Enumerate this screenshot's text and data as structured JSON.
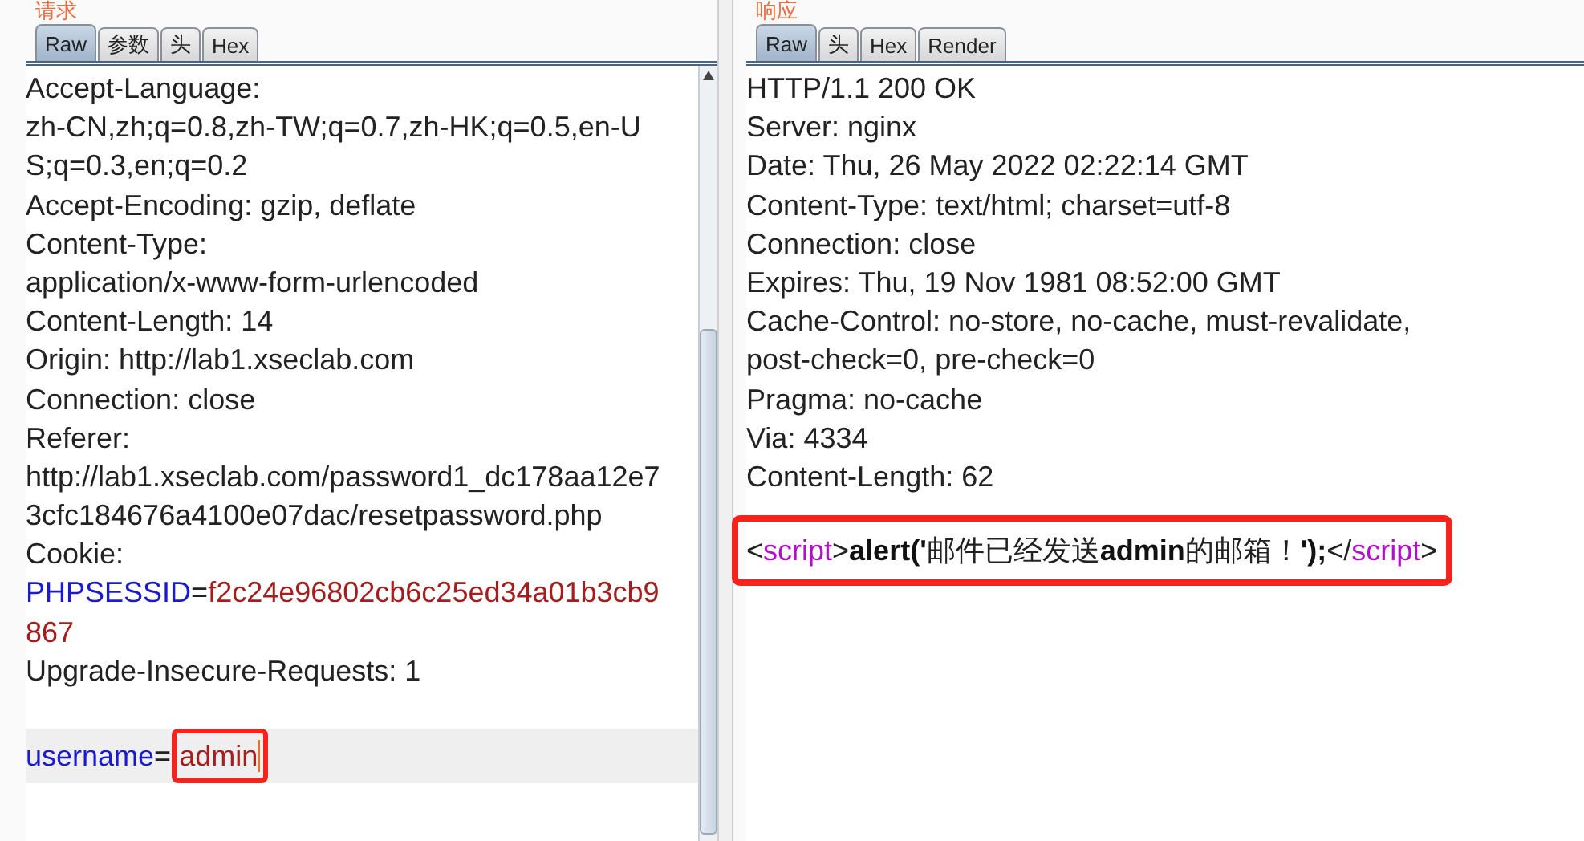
{
  "request": {
    "heading": "请求",
    "tabs": [
      {
        "label": "Raw",
        "selected": true
      },
      {
        "label": "参数",
        "selected": false
      },
      {
        "label": "头",
        "selected": false
      },
      {
        "label": "Hex",
        "selected": false
      }
    ],
    "lines": [
      {
        "segments": [
          {
            "text": "Accept-Language:",
            "kind": "plain"
          }
        ]
      },
      {
        "segments": [
          {
            "text": "zh-CN,zh;q=0.8,zh-TW;q=0.7,zh-HK;q=0.5,en-U",
            "kind": "plain"
          }
        ]
      },
      {
        "segments": [
          {
            "text": "S;q=0.3,en;q=0.2",
            "kind": "plain"
          }
        ]
      },
      {
        "segments": [
          {
            "text": "Accept-Encoding: gzip, deflate",
            "kind": "plain"
          }
        ]
      },
      {
        "segments": [
          {
            "text": "Content-Type:",
            "kind": "plain"
          }
        ]
      },
      {
        "segments": [
          {
            "text": "application/x-www-form-urlencoded",
            "kind": "plain"
          }
        ]
      },
      {
        "segments": [
          {
            "text": "Content-Length: 14",
            "kind": "plain"
          }
        ]
      },
      {
        "segments": [
          {
            "text": "Origin: http://lab1.xseclab.com",
            "kind": "plain"
          }
        ]
      },
      {
        "segments": [
          {
            "text": "Connection: close",
            "kind": "plain"
          }
        ]
      },
      {
        "segments": [
          {
            "text": "Referer:",
            "kind": "plain"
          }
        ]
      },
      {
        "segments": [
          {
            "text": "http://lab1.xseclab.com/password1_dc178aa12e7",
            "kind": "plain"
          }
        ]
      },
      {
        "segments": [
          {
            "text": "3cfc184676a4100e07dac/resetpassword.php",
            "kind": "plain"
          }
        ]
      },
      {
        "segments": [
          {
            "text": "Cookie:",
            "kind": "plain"
          }
        ]
      },
      {
        "segments": [
          {
            "text": "PHPSESSID",
            "kind": "name"
          },
          {
            "text": "=",
            "kind": "plain"
          },
          {
            "text": "f2c24e96802cb6c25ed34a01b3cb9",
            "kind": "value"
          }
        ]
      },
      {
        "segments": [
          {
            "text": "867",
            "kind": "value"
          }
        ]
      },
      {
        "segments": [
          {
            "text": "Upgrade-Insecure-Requests: 1",
            "kind": "plain"
          }
        ]
      },
      {
        "kind": "body",
        "segments": [
          {
            "text": "username",
            "kind": "name"
          },
          {
            "text": "=",
            "kind": "plain"
          },
          {
            "text": "admin",
            "kind": "value",
            "boxed": true,
            "caret": true
          }
        ]
      }
    ]
  },
  "response": {
    "heading": "响应",
    "tabs": [
      {
        "label": "Raw",
        "selected": true
      },
      {
        "label": "头",
        "selected": false
      },
      {
        "label": "Hex",
        "selected": false
      },
      {
        "label": "Render",
        "selected": false
      }
    ],
    "lines": [
      {
        "segments": [
          {
            "text": "HTTP/1.1 200 OK",
            "kind": "plain"
          }
        ]
      },
      {
        "segments": [
          {
            "text": "Server: nginx",
            "kind": "plain"
          }
        ]
      },
      {
        "segments": [
          {
            "text": "Date: Thu, 26 May 2022 02:22:14 GMT",
            "kind": "plain"
          }
        ]
      },
      {
        "segments": [
          {
            "text": "Content-Type: text/html; charset=utf-8",
            "kind": "plain"
          }
        ]
      },
      {
        "segments": [
          {
            "text": "Connection: close",
            "kind": "plain"
          }
        ]
      },
      {
        "segments": [
          {
            "text": "Expires: Thu, 19 Nov 1981 08:52:00 GMT",
            "kind": "plain"
          }
        ]
      },
      {
        "segments": [
          {
            "text": "Cache-Control: no-store, no-cache, must-revalidate,",
            "kind": "plain"
          }
        ]
      },
      {
        "segments": [
          {
            "text": "post-check=0, pre-check=0",
            "kind": "plain"
          }
        ]
      },
      {
        "segments": [
          {
            "text": "Pragma: no-cache",
            "kind": "plain"
          }
        ]
      },
      {
        "segments": [
          {
            "text": "Via: 4334",
            "kind": "plain"
          }
        ]
      },
      {
        "segments": [
          {
            "text": "Content-Length: 62",
            "kind": "plain"
          }
        ]
      },
      {
        "kind": "alert",
        "segments": [
          {
            "text": "<",
            "kind": "plain"
          },
          {
            "text": "script",
            "kind": "tag"
          },
          {
            "text": ">",
            "kind": "plain"
          },
          {
            "text": "alert('",
            "kind": "bold"
          },
          {
            "text": "邮件已经发送",
            "kind": "plain"
          },
          {
            "text": "admin",
            "kind": "bold"
          },
          {
            "text": "的邮箱！",
            "kind": "plain"
          },
          {
            "text": "');",
            "kind": "bold"
          },
          {
            "text": "</",
            "kind": "plain"
          },
          {
            "text": "script",
            "kind": "tag"
          },
          {
            "text": ">",
            "kind": "plain"
          }
        ]
      }
    ]
  }
}
